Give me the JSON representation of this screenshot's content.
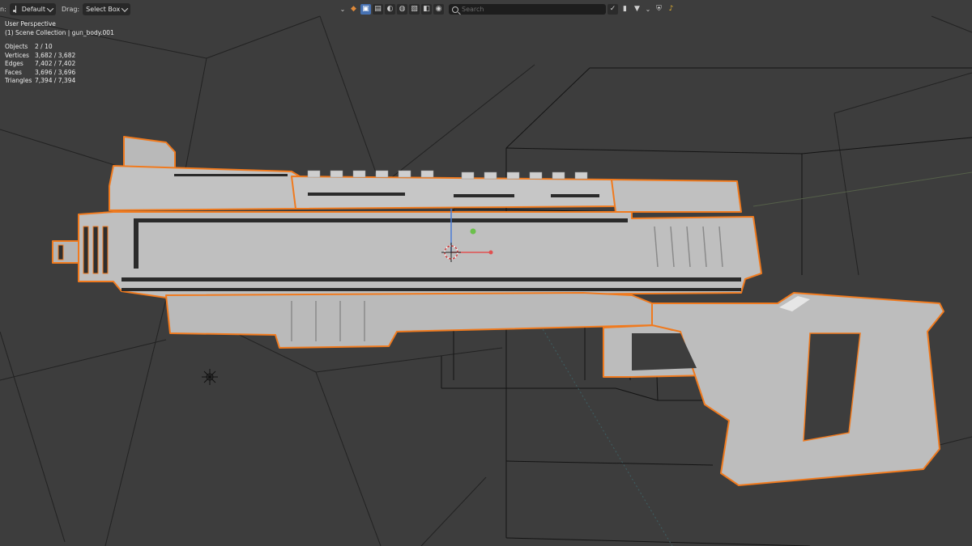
{
  "header": {
    "orientation_label": "n:",
    "orientation_value": "Default",
    "drag_label": "Drag:",
    "drag_value": "Select Box"
  },
  "toolbar": {
    "icons": [
      "chevron-down-icon",
      "mesh-data-icon",
      "select-icon",
      "outliner-icon",
      "sphere-icon",
      "globe-icon",
      "image-icon",
      "scene-icon",
      "camera-icon",
      "bookmark-icon",
      "filter-icon",
      "shield-icon",
      "bell-icon"
    ],
    "search_placeholder": "Search",
    "search_value": ""
  },
  "overlay": {
    "view_name": "User Perspective",
    "collection": "(1) Scene Collection | gun_body.001",
    "stats": [
      {
        "label": "Objects",
        "value": "2 / 10"
      },
      {
        "label": "Vertices",
        "value": "3,682 / 3,682"
      },
      {
        "label": "Edges",
        "value": "7,402 / 7,402"
      },
      {
        "label": "Faces",
        "value": "3,696 / 3,696"
      },
      {
        "label": "Triangles",
        "value": "7,394 / 7,394"
      }
    ]
  },
  "colors": {
    "viewport_bg": "#3d3d3d",
    "selection_outline": "#f07a1e",
    "mesh_fill": "#bdbdbd",
    "active_button": "#4772b3"
  }
}
